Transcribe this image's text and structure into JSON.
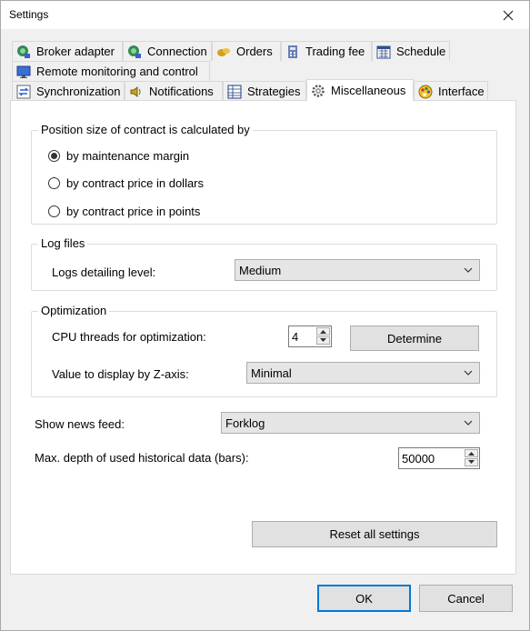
{
  "window": {
    "title": "Settings"
  },
  "tabs": {
    "row1": [
      "Broker adapter",
      "Connection",
      "Orders",
      "Trading fee",
      "Schedule"
    ],
    "row2": [
      "Remote monitoring and control"
    ],
    "row3": [
      "Synchronization",
      "Notifications",
      "Strategies",
      "Miscellaneous",
      "Interface"
    ],
    "active": "Miscellaneous"
  },
  "position_group": {
    "legend": "Position size of contract is calculated by",
    "options": [
      "by maintenance margin",
      "by contract price in dollars",
      "by contract price in points"
    ],
    "selected": "by maintenance margin"
  },
  "log_group": {
    "legend": "Log files",
    "label": "Logs detailing level:",
    "value": "Medium"
  },
  "optimization_group": {
    "legend": "Optimization",
    "cpu_label": "CPU threads for optimization:",
    "cpu_value": "4",
    "determine_label": "Determine",
    "zaxis_label": "Value to display by Z-axis:",
    "zaxis_value": "Minimal"
  },
  "news": {
    "label": "Show news feed:",
    "value": "Forklog"
  },
  "depth": {
    "label": "Max. depth of used historical data (bars):",
    "value": "50000"
  },
  "reset_label": "Reset all settings",
  "footer": {
    "ok_label": "OK",
    "cancel_label": "Cancel"
  }
}
